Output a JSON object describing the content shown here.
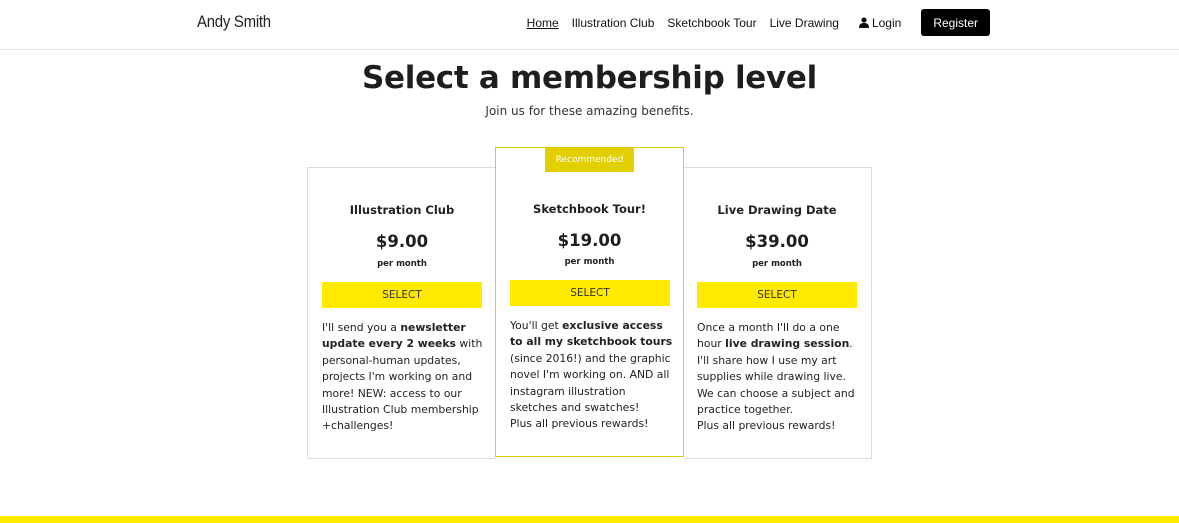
{
  "header": {
    "brand": "Andy Smith",
    "nav": [
      {
        "label": "Home",
        "active": true
      },
      {
        "label": "Illustration Club"
      },
      {
        "label": "Sketchbook Tour"
      },
      {
        "label": "Live Drawing"
      }
    ],
    "login_label": "Login",
    "login_icon": "user-icon",
    "register_label": "Register"
  },
  "page": {
    "title": "Select a membership level",
    "subtitle": "Join us for these amazing benefits."
  },
  "plans": [
    {
      "name": "Illustration Club",
      "price": "$9.00",
      "period": "per month",
      "button": "SELECT",
      "description": [
        {
          "text": "I'll send you a "
        },
        {
          "text": "newsletter update every 2 weeks",
          "bold": true
        },
        {
          "text": " with personal-human updates, projects I'm working on and more! NEW: access to our Illustration Club membership +challenges!"
        }
      ]
    },
    {
      "name": "Sketchbook Tour!",
      "price": "$19.00",
      "period": "per month",
      "button": "SELECT",
      "badge": "Recommended",
      "description": [
        {
          "text": "You'll get "
        },
        {
          "text": "exclusive access to all my sketchbook tours",
          "bold": true
        },
        {
          "text": " (since 2016!) and the graphic novel I'm working on. AND all instagram illustration sketches and swatches!"
        },
        {
          "text": "Plus all previous rewards!",
          "newline": true
        }
      ]
    },
    {
      "name": "Live Drawing Date",
      "price": "$39.00",
      "period": "per month",
      "button": "SELECT",
      "description": [
        {
          "text": "Once a month I'll do a one hour "
        },
        {
          "text": "live drawing session",
          "bold": true
        },
        {
          "text": ". I'll share how I use my art supplies while drawing live. We can choose a subject and practice together."
        },
        {
          "text": "Plus all previous rewards!",
          "newline": true
        }
      ]
    }
  ],
  "colors": {
    "accent": "#ffea00",
    "badge": "#e2cf00",
    "register_bg": "#000000"
  }
}
